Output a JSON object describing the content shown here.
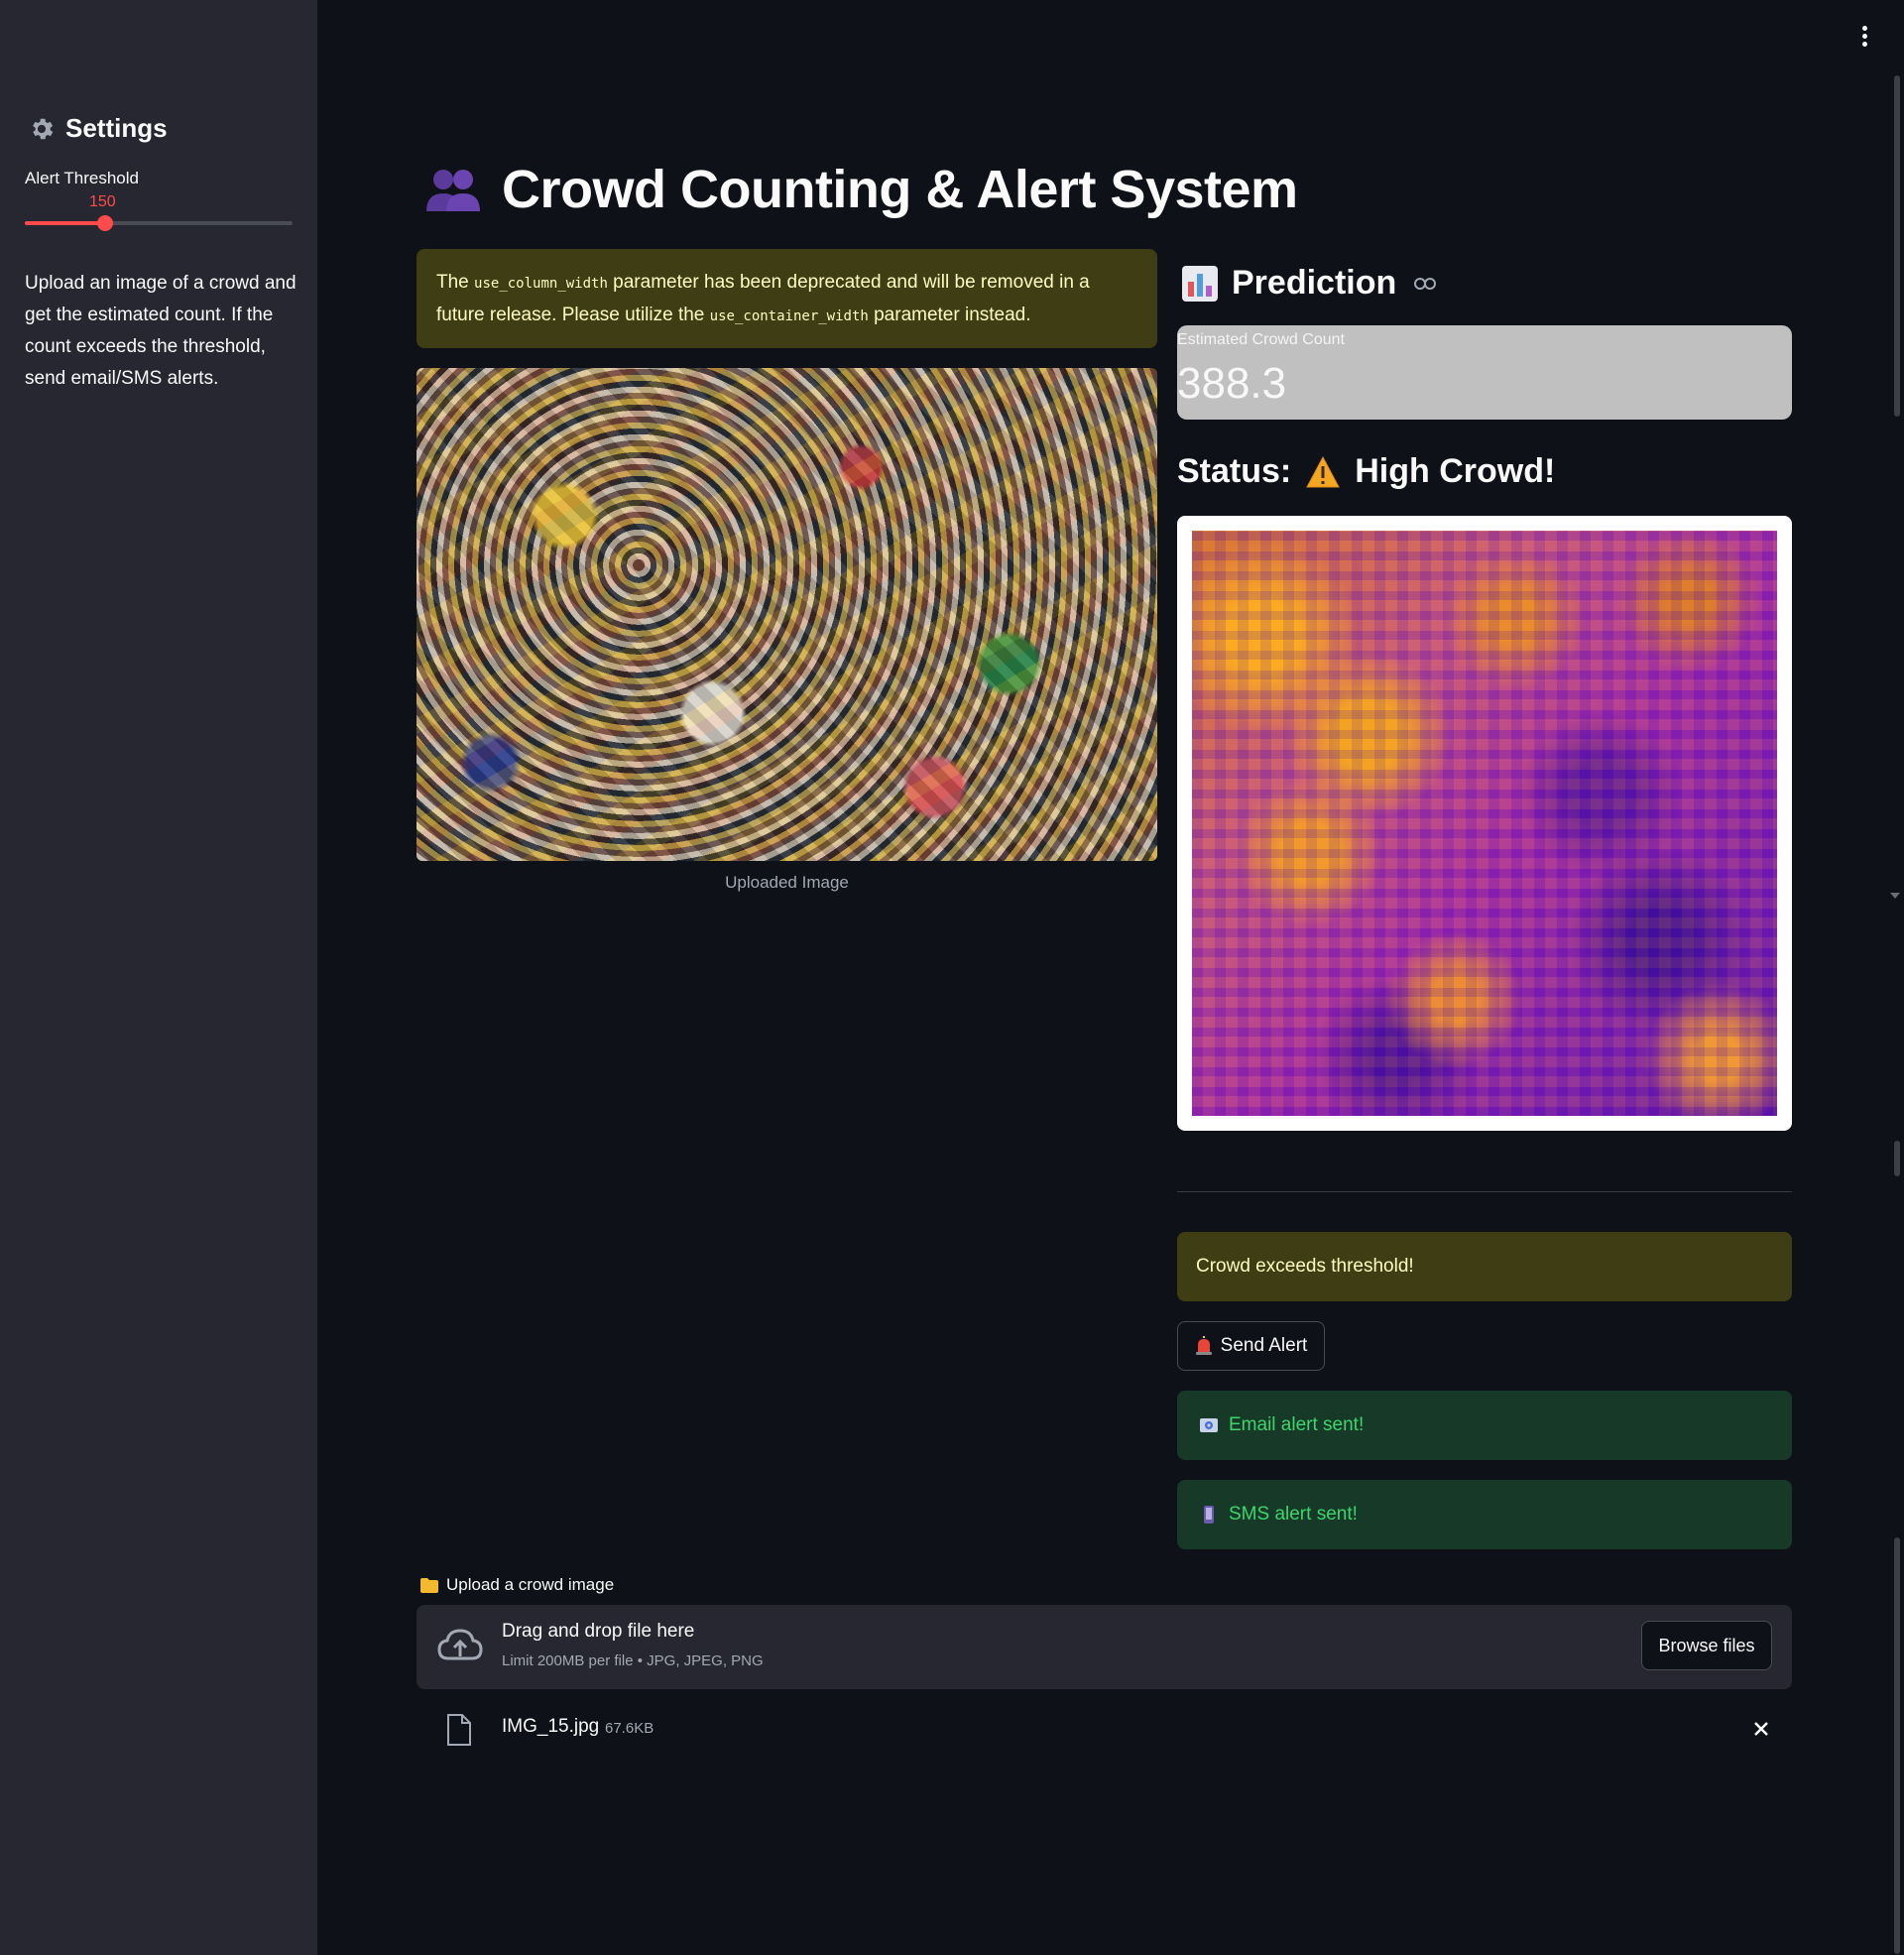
{
  "sidebar": {
    "title": "Settings",
    "slider": {
      "label": "Alert Threshold",
      "value": "150",
      "min": 0,
      "max": 500,
      "fraction": 0.3
    },
    "description": "Upload an image of a crowd and get the estimated count. If the count exceeds the threshold, send email/SMS alerts."
  },
  "header": {
    "title": "Crowd Counting & Alert System",
    "icon": "people-icon"
  },
  "deprecation_warning": {
    "pre": "The ",
    "code1": "use_column_width",
    "mid": " parameter has been deprecated and will be removed in a future release. Please utilize the ",
    "code2": "use_container_width",
    "post": " parameter instead."
  },
  "uploaded_image": {
    "caption": "Uploaded Image"
  },
  "prediction": {
    "heading": "Prediction",
    "metric_label": "Estimated Crowd Count",
    "metric_value": "388.3",
    "status_label": "Status:",
    "status_value": "High Crowd!"
  },
  "alerts": {
    "threshold_warning": "Crowd exceeds threshold!",
    "send_button": "Send Alert",
    "email_success": "Email alert sent!",
    "sms_success": "SMS alert sent!"
  },
  "uploader": {
    "label": "Upload a crowd image",
    "drop_text": "Drag and drop file here",
    "limit_text": "Limit 200MB per file • JPG, JPEG, PNG",
    "browse_button": "Browse files",
    "file": {
      "name": "IMG_15.jpg",
      "size": "67.6KB"
    }
  },
  "colors": {
    "background": "#0e1117",
    "sidebar": "#262730",
    "accent": "#ff4b4b",
    "warning_bg": "#3e3d14",
    "warning_text": "#fffbc4",
    "success_bg": "#173928",
    "success_text": "#3dd56d"
  }
}
